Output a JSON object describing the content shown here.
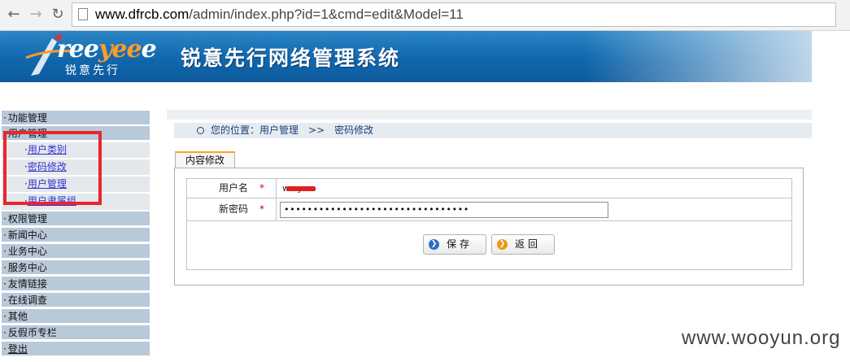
{
  "browser": {
    "back_icon": "back-arrow-icon",
    "forward_icon": "forward-arrow-icon",
    "reload_icon": "reload-icon",
    "url_host": "www.dfrcb.com",
    "url_path": "/admin/index.php?id=1&cmd=edit&Model=11"
  },
  "header": {
    "logo_text_pre": "ree",
    "logo_text_accent": "yee",
    "logo_text_post": "e",
    "logo_sub": "锐意先行",
    "title": "锐意先行网络管理系统"
  },
  "sidebar": {
    "items": [
      {
        "label": "功能管理"
      },
      {
        "label": "用户管理"
      },
      {
        "label": "权限管理"
      },
      {
        "label": "新闻中心"
      },
      {
        "label": "业务中心"
      },
      {
        "label": "服务中心"
      },
      {
        "label": "友情链接"
      },
      {
        "label": "在线调查"
      },
      {
        "label": "其他"
      },
      {
        "label": "反假币专栏"
      },
      {
        "label": "登出"
      }
    ],
    "sub_items": [
      {
        "label": "用户类别"
      },
      {
        "label": "密码修改"
      },
      {
        "label": "用户管理"
      },
      {
        "label": "用户隶属组"
      }
    ],
    "bullet": "·"
  },
  "main": {
    "breadcrumb_prefix": "您的位置：",
    "breadcrumb_section": "用户管理",
    "breadcrumb_sep": ">>",
    "breadcrumb_page": "密码修改",
    "tab_label": "内容修改",
    "form": {
      "username_label": "用户名",
      "username_value": "w...y",
      "password_label": "新密码",
      "password_value": "••••••••••••••••••••••••••••••••",
      "required_mark": "*"
    },
    "save_label": "保存",
    "back_label": "返回"
  },
  "watermark": "www.wooyun.org",
  "colors": {
    "header_blue": "#1167ac",
    "menu_bg": "#b8c9d9",
    "highlight_red": "#e8262f",
    "tab_accent": "#f5a623"
  }
}
